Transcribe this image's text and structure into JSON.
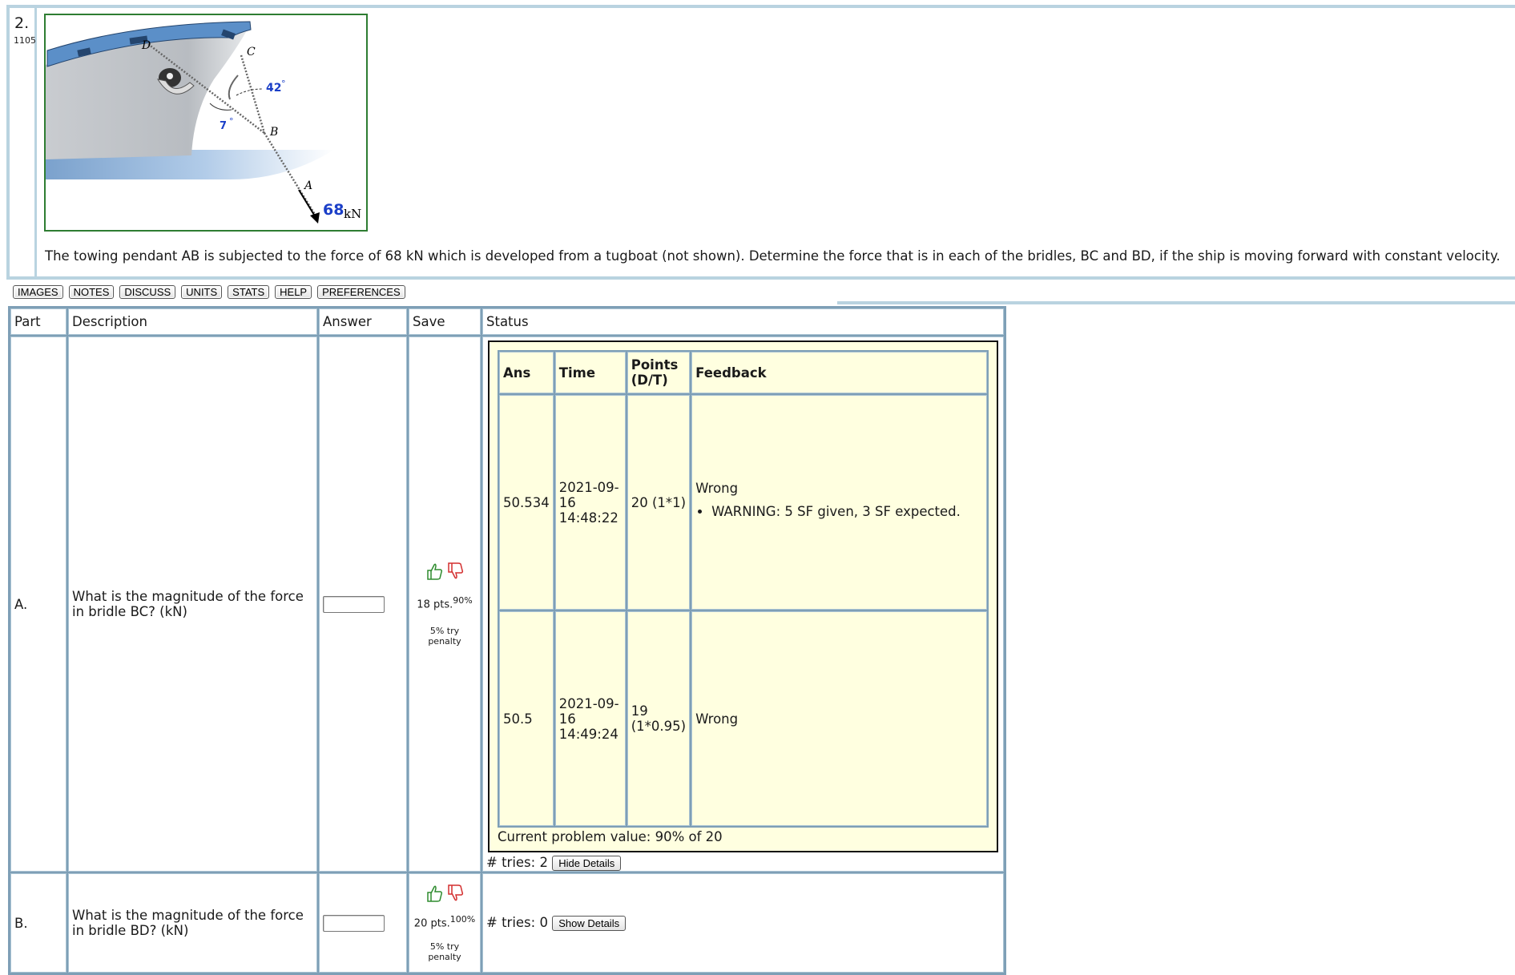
{
  "problem": {
    "number": "2.",
    "id": "1105",
    "statement": "The towing pendant AB is subjected to the force of 68 kN which is developed from a tugboat (not shown). Determine the force that is in each of the bridles, BC and BD, if the ship is moving forward with constant velocity.",
    "figure": {
      "labels": {
        "D": "D",
        "C": "C",
        "B": "B",
        "A": "A"
      },
      "angle1": "42",
      "angle2": "7",
      "degree": "°",
      "force_value": "68",
      "force_unit": "kN"
    }
  },
  "toolbar": {
    "buttons": [
      "IMAGES",
      "NOTES",
      "DISCUSS",
      "UNITS",
      "STATS",
      "HELP",
      "PREFERENCES"
    ]
  },
  "table": {
    "headers": {
      "part": "Part",
      "description": "Description",
      "answer": "Answer",
      "save": "Save",
      "status": "Status"
    },
    "rows": [
      {
        "part": "A.",
        "description": "What is the magnitude of the force in bridle BC? (kN)",
        "points": "18 pts.",
        "percent": "90%",
        "penalty": "5% try penalty",
        "feedback": {
          "headers": {
            "ans": "Ans",
            "time": "Time",
            "points": "Points (D/T)",
            "feedback": "Feedback"
          },
          "entries": [
            {
              "ans": "50.534",
              "time": "2021-09-16 14:48:22",
              "points": "20 (1*1)",
              "result": "Wrong",
              "warning": "WARNING: 5 SF given, 3 SF expected."
            },
            {
              "ans": "50.5",
              "time": "2021-09-16 14:49:24",
              "points": "19 (1*0.95)",
              "result": "Wrong"
            }
          ],
          "current_value": "Current problem value: 90% of 20"
        },
        "tries": "# tries: 2",
        "details_button": "Hide Details"
      },
      {
        "part": "B.",
        "description": "What is the magnitude of the force in bridle BD? (kN)",
        "points": "20 pts.",
        "percent": "100%",
        "penalty": "5% try penalty",
        "tries": "# tries: 0",
        "details_button": "Show Details"
      }
    ]
  }
}
